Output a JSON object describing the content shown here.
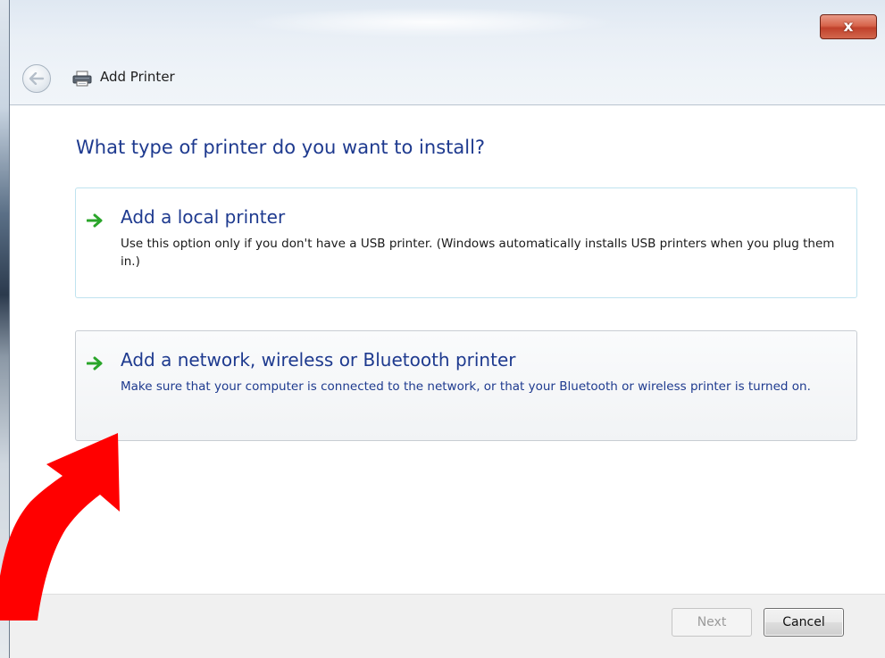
{
  "window": {
    "title": "Add Printer",
    "close_label": "x"
  },
  "wizard": {
    "heading": "What type of printer do you want to install?",
    "options": [
      {
        "title": "Add a local printer",
        "description": "Use this option only if you don't have a USB printer. (Windows automatically installs USB printers when you plug them in.)",
        "state": "default"
      },
      {
        "title": "Add a network, wireless or Bluetooth printer",
        "description": "Make sure that your computer is connected to the network, or that your Bluetooth or wireless printer is turned on.",
        "state": "hover"
      }
    ]
  },
  "footer": {
    "next_label": "Next",
    "next_enabled": false,
    "cancel_label": "Cancel"
  },
  "icons": {
    "back": "back-arrow-icon",
    "printer": "printer-icon",
    "option_arrow": "green-arrow-icon",
    "close": "close-icon",
    "annotation": "red-annotation-arrow"
  },
  "colors": {
    "heading": "#1e3a8f",
    "option_arrow": "#2aa52a",
    "close_button": "#c9503a",
    "annotation_arrow": "#ff0000"
  }
}
